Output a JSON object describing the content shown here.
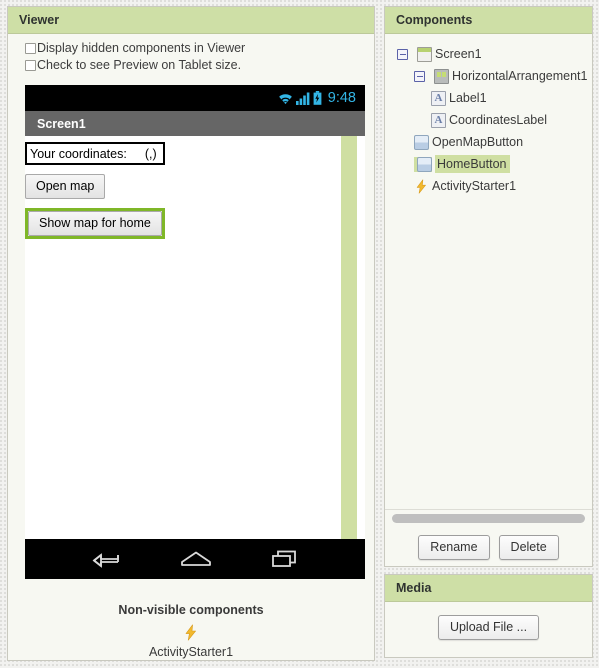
{
  "viewer": {
    "header": "Viewer",
    "checkboxes": [
      {
        "label": "Display hidden components in Viewer",
        "checked": false
      },
      {
        "label": "Check to see Preview on Tablet size.",
        "checked": false
      }
    ],
    "phone": {
      "status": {
        "time": "9:48",
        "icons": [
          "wifi-icon",
          "signal-icon",
          "battery-charging-icon"
        ]
      },
      "title": "Screen1",
      "arrangement": {
        "label1": "Your coordinates:",
        "coordinates_label": "(,)"
      },
      "buttons": [
        {
          "text": "Open map",
          "selected": false
        },
        {
          "text": "Show map for home",
          "selected": true
        }
      ],
      "navbar": [
        "back-icon",
        "home-icon",
        "recents-icon"
      ]
    },
    "nonvisible": {
      "title": "Non-visible components",
      "items": [
        {
          "name": "ActivityStarter1",
          "icon": "bolt-icon"
        }
      ]
    }
  },
  "components": {
    "header": "Components",
    "tree": [
      {
        "label": "Screen1",
        "icon": "screen-icon",
        "depth": 0,
        "toggle": "collapse",
        "selected": false
      },
      {
        "label": "HorizontalArrangement1",
        "icon": "horizontal-arrangement-icon",
        "depth": 1,
        "toggle": "collapse",
        "selected": false
      },
      {
        "label": "Label1",
        "icon": "label-icon",
        "depth": 2,
        "toggle": "none",
        "selected": false
      },
      {
        "label": "CoordinatesLabel",
        "icon": "label-icon",
        "depth": 2,
        "toggle": "none",
        "selected": false
      },
      {
        "label": "OpenMapButton",
        "icon": "button-icon",
        "depth": 1,
        "toggle": "none",
        "selected": false
      },
      {
        "label": "HomeButton",
        "icon": "button-icon",
        "depth": 1,
        "toggle": "none",
        "selected": true
      },
      {
        "label": "ActivityStarter1",
        "icon": "bolt-icon",
        "depth": 1,
        "toggle": "none",
        "selected": false
      }
    ],
    "buttons": {
      "rename": "Rename",
      "delete": "Delete"
    }
  },
  "media": {
    "header": "Media",
    "upload_button": "Upload File ..."
  },
  "colors": {
    "panel_header_green": "#cedfa6",
    "selection_green": "#7fb728",
    "highlight_green": "#cfdfa2",
    "status_accent": "#33b5e5",
    "titlebar_gray": "#666666"
  }
}
